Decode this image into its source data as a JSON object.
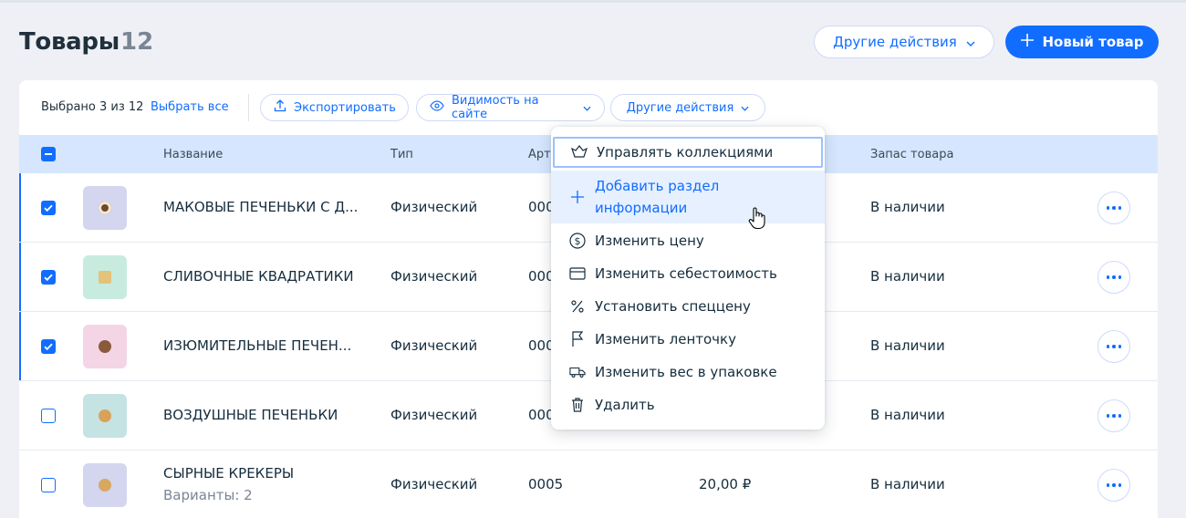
{
  "header": {
    "title": "Товары",
    "count": "12",
    "other_actions_label": "Другие действия",
    "new_product_label": "Новый товар"
  },
  "toolbar": {
    "selected_text": "Выбрано 3 из 12",
    "select_all_label": "Выбрать все",
    "export_label": "Экспортировать",
    "visibility_label": "Видимость на сайте",
    "other_actions_label": "Другие действия"
  },
  "table": {
    "columns": [
      "Название",
      "Тип",
      "Арт",
      "Запас товара"
    ],
    "rows": [
      {
        "name": "МАКОВЫЕ ПЕЧЕНЬКИ С Д...",
        "type": "Физический",
        "sku": "000",
        "stock": "В наличии",
        "checked": true,
        "thumb_bg": "#d4d5ee",
        "cookie": "#6b4a2f"
      },
      {
        "name": "СЛИВОЧНЫЕ КВАДРАТИКИ",
        "type": "Физический",
        "sku": "000",
        "stock": "В наличии",
        "checked": true,
        "thumb_bg": "#c8ebdf",
        "cookie": "#e3c27a"
      },
      {
        "name": "ИЗЮМИТЕЛЬНЫЕ ПЕЧЕН...",
        "type": "Физический",
        "sku": "000",
        "stock": "В наличии",
        "checked": true,
        "thumb_bg": "#f4d5e5",
        "cookie": "#8a5a3a"
      },
      {
        "name": "ВОЗДУШНЫЕ ПЕЧЕНЬКИ",
        "type": "Физический",
        "sku": "000",
        "stock": "В наличии",
        "checked": false,
        "thumb_bg": "#c6e3e3",
        "cookie": "#d9a25a"
      },
      {
        "name": "СЫРНЫЕ КРЕКЕРЫ",
        "sub": "Варианты: 2",
        "type": "Физический",
        "sku": "0005",
        "price": "20,00 ₽",
        "stock": "В наличии",
        "checked": false,
        "thumb_bg": "#d4d5ee",
        "cookie": "#d8a860"
      }
    ]
  },
  "menu": {
    "items": [
      {
        "label": "Управлять коллекциями",
        "icon": "collections-icon"
      },
      {
        "label": "Добавить раздел",
        "label2": "информации",
        "icon": "plus-icon"
      },
      {
        "label": "Изменить цену",
        "icon": "price-icon"
      },
      {
        "label": "Изменить себестоимость",
        "icon": "cost-icon"
      },
      {
        "label": "Установить спеццену",
        "icon": "percent-icon"
      },
      {
        "label": "Изменить ленточку",
        "icon": "ribbon-flag-icon"
      },
      {
        "label": "Изменить вес в упаковке",
        "icon": "shipping-truck-icon"
      },
      {
        "label": "Удалить",
        "icon": "trash-icon"
      }
    ]
  },
  "colors": {
    "accent": "#116dff",
    "header_row": "#d6e6fe",
    "background": "#eef0f5",
    "menu_hover": "#e7f0ff"
  }
}
